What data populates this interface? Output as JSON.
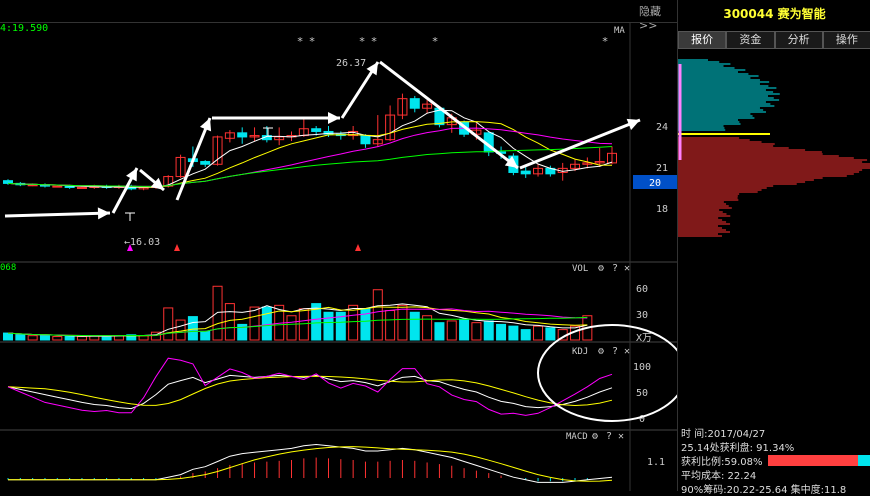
{
  "header": {
    "price_text": "4:19.590",
    "hide_label": "隐藏>>",
    "stock_code": "300044",
    "stock_name": "赛为智能",
    "tabs": [
      {
        "label": "报价"
      },
      {
        "label": "资金"
      },
      {
        "label": "分析"
      },
      {
        "label": "操作"
      }
    ]
  },
  "main_chart": {
    "ma_label": "MA",
    "high_label": "26.37",
    "low_label": "16.03",
    "price_axis": [
      {
        "label": "24",
        "value": 24
      },
      {
        "label": "21",
        "value": 21
      },
      {
        "label": "18",
        "value": 18
      }
    ],
    "current_price_label": "20",
    "star_marks": "*"
  },
  "volume_panel": {
    "name": "VOL",
    "corner_label": "068",
    "axis": [
      "60",
      "30"
    ],
    "unit": "X万",
    "bars": [
      8,
      6,
      5,
      5,
      4,
      4,
      4,
      5,
      5,
      5,
      6,
      5,
      9,
      37,
      23,
      27,
      10,
      62,
      42,
      18,
      38,
      38,
      40,
      28,
      36,
      42,
      32,
      32,
      40,
      36,
      58,
      34,
      40,
      32,
      28,
      20,
      22,
      24,
      20,
      22,
      18,
      16,
      12,
      16,
      14,
      12,
      16,
      28
    ]
  },
  "kdj_panel": {
    "name": "KDJ",
    "axis": [
      "100",
      "50",
      "0"
    ]
  },
  "macd_panel": {
    "name": "MACD",
    "axis": [
      "1.1"
    ]
  },
  "icons": {
    "gear": "⚙",
    "help": "?",
    "close": "✕"
  },
  "info": {
    "time_label": "时    间:2017/04/27",
    "profit_line": "25.14处获利盘: 91.34%",
    "profit_ratio": "获利比例:59.08%",
    "avg_cost": "平均成本: 22.24",
    "chip90": "90%筹码:20.22-25.64 集中度:11.8"
  },
  "colors": {
    "up": "#ff3232",
    "down": "#00e5ee",
    "ma1": "#ffffff",
    "ma2": "#ffff00",
    "ma3": "#ff00ff",
    "ma4": "#00ff00",
    "highlight": "#0050c8"
  }
}
